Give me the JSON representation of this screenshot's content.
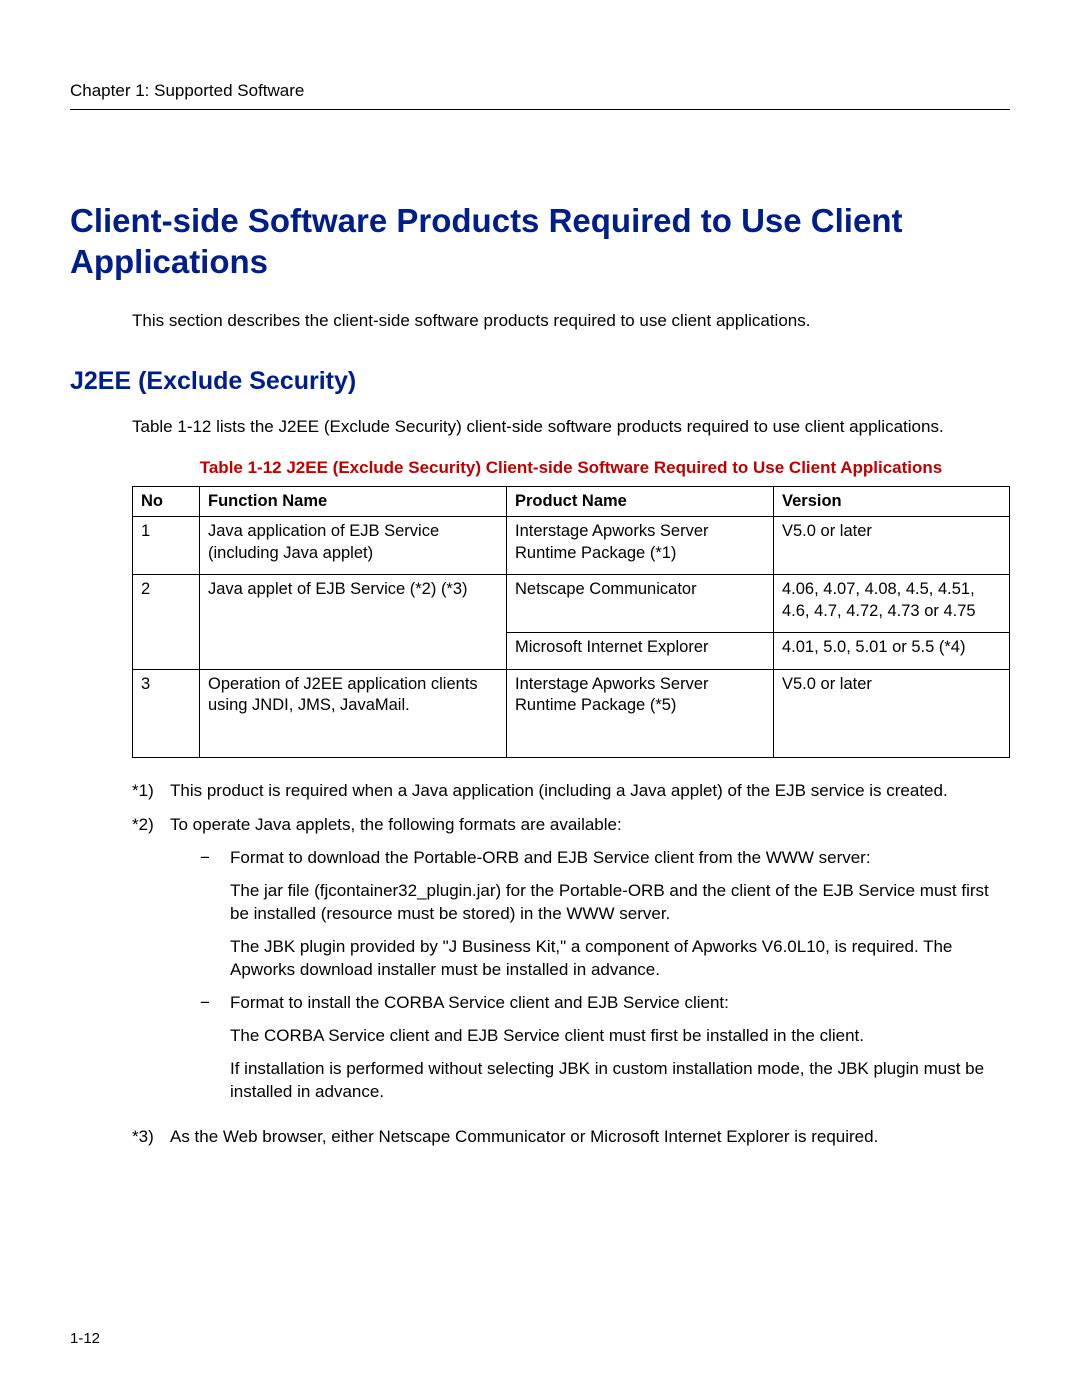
{
  "header": {
    "chapter": "Chapter 1:  Supported Software"
  },
  "title": "Client-side Software Products Required to Use Client Applications",
  "intro": "This section describes the client-side software products required to use client applications.",
  "subtitle": "J2EE (Exclude Security)",
  "section_intro": "Table 1-12 lists the J2EE (Exclude Security) client-side software products required to use client applications.",
  "table": {
    "caption": "Table 1-12  J2EE (Exclude Security) Client-side Software Required to Use Client Applications",
    "headers": {
      "no": "No",
      "function": "Function Name",
      "product": "Product Name",
      "version": "Version"
    },
    "rows": {
      "r1": {
        "no": "1",
        "function": "Java application of EJB Service (including Java applet)",
        "product": "Interstage Apworks Server Runtime Package (*1)",
        "version": "V5.0 or later"
      },
      "r2a": {
        "no": "2",
        "function": "Java applet of EJB Service  (*2) (*3)",
        "product": "Netscape Communicator",
        "version": "4.06, 4.07, 4.08, 4.5, 4.51, 4.6, 4.7, 4.72, 4.73 or 4.75"
      },
      "r2b": {
        "product": "Microsoft Internet Explorer",
        "version": "4.01, 5.0, 5.01 or 5.5 (*4)"
      },
      "r3": {
        "no": "3",
        "function": "Operation of J2EE application clients using JNDI, JMS, JavaMail.",
        "product": "Interstage Apworks Server Runtime Package (*5)",
        "version": "V5.0 or later"
      }
    }
  },
  "notes": {
    "n1": {
      "label": "*1)",
      "text": "This product is required when a Java application (including a Java applet) of the EJB service is created."
    },
    "n2": {
      "label": "*2)",
      "text": "To operate Java applets, the following formats are available:",
      "sub_a_head": "Format to download the Portable-ORB and EJB Service client from the WWW server:",
      "sub_a_p1": "The jar file (fjcontainer32_plugin.jar) for the Portable-ORB and the client of the EJB Service must first be installed (resource must be stored) in the WWW server.",
      "sub_a_p2": "The JBK plugin provided by \"J Business Kit,\" a component of Apworks V6.0L10, is required. The Apworks download installer must be installed in advance.",
      "sub_b_head": "Format to install the CORBA Service client and EJB Service client:",
      "sub_b_p1": "The CORBA Service client and EJB Service client must first be installed in the client.",
      "sub_b_p2": "If installation is performed without selecting JBK in custom installation mode, the JBK plugin must be installed in advance."
    },
    "n3": {
      "label": "*3)",
      "text": "As the Web browser, either Netscape Communicator or Microsoft Internet Explorer is required."
    }
  },
  "dash": "−",
  "footer": {
    "page": "1-12"
  }
}
